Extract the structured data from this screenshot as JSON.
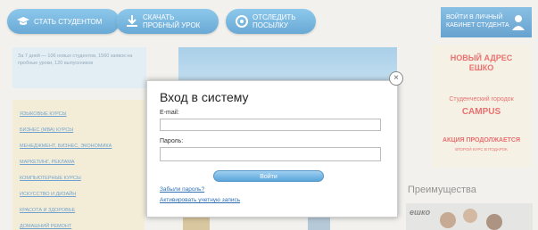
{
  "header": {
    "buttons": [
      {
        "label": "Стать студентом",
        "icon": "graduation-cap-icon"
      },
      {
        "label": "Скачать\nпробный урок",
        "icon": "download-icon"
      },
      {
        "label": "Отследить\nпосылку",
        "icon": "tracking-icon"
      }
    ],
    "cabinet": {
      "label": "Войти в личный кабинет студента",
      "icon": "student-icon"
    }
  },
  "info_box": {
    "text": "За 7 дней — 106 новых студентов, 1560 заявок на пробные уроки, 120 выпускников"
  },
  "sidebar": {
    "items": [
      "Языковые курсы",
      "Бизнес (МВА) курсы",
      "Менеджмент, бизнес, экономика",
      "Маркетинг, реклама",
      "Компьютерные курсы",
      "Искусство и дизайн",
      "Красота и здоровье",
      "Домашний ремонт"
    ]
  },
  "promo": {
    "line1": "Новый адрес ЕШКО",
    "line2": "Студенческий городок",
    "line3": "CAMPUS",
    "line4": "Акция продолжается",
    "line5": "второй курс в подарок"
  },
  "advantages": {
    "title": "Преимущества",
    "logo": "ешко"
  },
  "login_modal": {
    "title": "Вход в систему",
    "email_label": "E-mail:",
    "email_value": "",
    "password_label": "Пароль:",
    "password_value": "",
    "submit_label": "Войти",
    "forgot_link": "Забыли пароль?",
    "activate_link": "Активировать учетную запись",
    "close_icon": "close-icon"
  }
}
